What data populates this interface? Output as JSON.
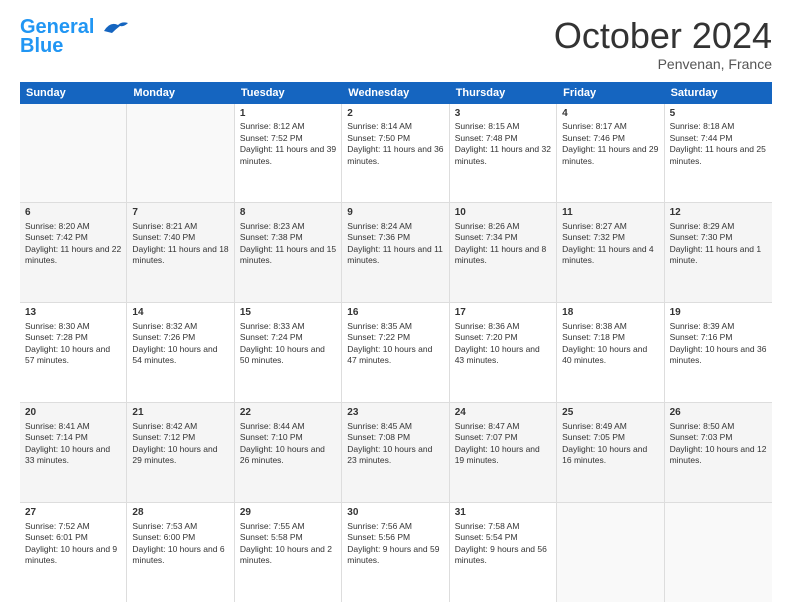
{
  "header": {
    "logo_line1": "General",
    "logo_line2": "Blue",
    "month": "October 2024",
    "location": "Penvenan, France"
  },
  "days_of_week": [
    "Sunday",
    "Monday",
    "Tuesday",
    "Wednesday",
    "Thursday",
    "Friday",
    "Saturday"
  ],
  "weeks": [
    [
      {
        "day": "",
        "empty": true
      },
      {
        "day": "",
        "empty": true
      },
      {
        "day": "1",
        "sunrise": "Sunrise: 8:12 AM",
        "sunset": "Sunset: 7:52 PM",
        "daylight": "Daylight: 11 hours and 39 minutes."
      },
      {
        "day": "2",
        "sunrise": "Sunrise: 8:14 AM",
        "sunset": "Sunset: 7:50 PM",
        "daylight": "Daylight: 11 hours and 36 minutes."
      },
      {
        "day": "3",
        "sunrise": "Sunrise: 8:15 AM",
        "sunset": "Sunset: 7:48 PM",
        "daylight": "Daylight: 11 hours and 32 minutes."
      },
      {
        "day": "4",
        "sunrise": "Sunrise: 8:17 AM",
        "sunset": "Sunset: 7:46 PM",
        "daylight": "Daylight: 11 hours and 29 minutes."
      },
      {
        "day": "5",
        "sunrise": "Sunrise: 8:18 AM",
        "sunset": "Sunset: 7:44 PM",
        "daylight": "Daylight: 11 hours and 25 minutes."
      }
    ],
    [
      {
        "day": "6",
        "sunrise": "Sunrise: 8:20 AM",
        "sunset": "Sunset: 7:42 PM",
        "daylight": "Daylight: 11 hours and 22 minutes."
      },
      {
        "day": "7",
        "sunrise": "Sunrise: 8:21 AM",
        "sunset": "Sunset: 7:40 PM",
        "daylight": "Daylight: 11 hours and 18 minutes."
      },
      {
        "day": "8",
        "sunrise": "Sunrise: 8:23 AM",
        "sunset": "Sunset: 7:38 PM",
        "daylight": "Daylight: 11 hours and 15 minutes."
      },
      {
        "day": "9",
        "sunrise": "Sunrise: 8:24 AM",
        "sunset": "Sunset: 7:36 PM",
        "daylight": "Daylight: 11 hours and 11 minutes."
      },
      {
        "day": "10",
        "sunrise": "Sunrise: 8:26 AM",
        "sunset": "Sunset: 7:34 PM",
        "daylight": "Daylight: 11 hours and 8 minutes."
      },
      {
        "day": "11",
        "sunrise": "Sunrise: 8:27 AM",
        "sunset": "Sunset: 7:32 PM",
        "daylight": "Daylight: 11 hours and 4 minutes."
      },
      {
        "day": "12",
        "sunrise": "Sunrise: 8:29 AM",
        "sunset": "Sunset: 7:30 PM",
        "daylight": "Daylight: 11 hours and 1 minute."
      }
    ],
    [
      {
        "day": "13",
        "sunrise": "Sunrise: 8:30 AM",
        "sunset": "Sunset: 7:28 PM",
        "daylight": "Daylight: 10 hours and 57 minutes."
      },
      {
        "day": "14",
        "sunrise": "Sunrise: 8:32 AM",
        "sunset": "Sunset: 7:26 PM",
        "daylight": "Daylight: 10 hours and 54 minutes."
      },
      {
        "day": "15",
        "sunrise": "Sunrise: 8:33 AM",
        "sunset": "Sunset: 7:24 PM",
        "daylight": "Daylight: 10 hours and 50 minutes."
      },
      {
        "day": "16",
        "sunrise": "Sunrise: 8:35 AM",
        "sunset": "Sunset: 7:22 PM",
        "daylight": "Daylight: 10 hours and 47 minutes."
      },
      {
        "day": "17",
        "sunrise": "Sunrise: 8:36 AM",
        "sunset": "Sunset: 7:20 PM",
        "daylight": "Daylight: 10 hours and 43 minutes."
      },
      {
        "day": "18",
        "sunrise": "Sunrise: 8:38 AM",
        "sunset": "Sunset: 7:18 PM",
        "daylight": "Daylight: 10 hours and 40 minutes."
      },
      {
        "day": "19",
        "sunrise": "Sunrise: 8:39 AM",
        "sunset": "Sunset: 7:16 PM",
        "daylight": "Daylight: 10 hours and 36 minutes."
      }
    ],
    [
      {
        "day": "20",
        "sunrise": "Sunrise: 8:41 AM",
        "sunset": "Sunset: 7:14 PM",
        "daylight": "Daylight: 10 hours and 33 minutes."
      },
      {
        "day": "21",
        "sunrise": "Sunrise: 8:42 AM",
        "sunset": "Sunset: 7:12 PM",
        "daylight": "Daylight: 10 hours and 29 minutes."
      },
      {
        "day": "22",
        "sunrise": "Sunrise: 8:44 AM",
        "sunset": "Sunset: 7:10 PM",
        "daylight": "Daylight: 10 hours and 26 minutes."
      },
      {
        "day": "23",
        "sunrise": "Sunrise: 8:45 AM",
        "sunset": "Sunset: 7:08 PM",
        "daylight": "Daylight: 10 hours and 23 minutes."
      },
      {
        "day": "24",
        "sunrise": "Sunrise: 8:47 AM",
        "sunset": "Sunset: 7:07 PM",
        "daylight": "Daylight: 10 hours and 19 minutes."
      },
      {
        "day": "25",
        "sunrise": "Sunrise: 8:49 AM",
        "sunset": "Sunset: 7:05 PM",
        "daylight": "Daylight: 10 hours and 16 minutes."
      },
      {
        "day": "26",
        "sunrise": "Sunrise: 8:50 AM",
        "sunset": "Sunset: 7:03 PM",
        "daylight": "Daylight: 10 hours and 12 minutes."
      }
    ],
    [
      {
        "day": "27",
        "sunrise": "Sunrise: 7:52 AM",
        "sunset": "Sunset: 6:01 PM",
        "daylight": "Daylight: 10 hours and 9 minutes."
      },
      {
        "day": "28",
        "sunrise": "Sunrise: 7:53 AM",
        "sunset": "Sunset: 6:00 PM",
        "daylight": "Daylight: 10 hours and 6 minutes."
      },
      {
        "day": "29",
        "sunrise": "Sunrise: 7:55 AM",
        "sunset": "Sunset: 5:58 PM",
        "daylight": "Daylight: 10 hours and 2 minutes."
      },
      {
        "day": "30",
        "sunrise": "Sunrise: 7:56 AM",
        "sunset": "Sunset: 5:56 PM",
        "daylight": "Daylight: 9 hours and 59 minutes."
      },
      {
        "day": "31",
        "sunrise": "Sunrise: 7:58 AM",
        "sunset": "Sunset: 5:54 PM",
        "daylight": "Daylight: 9 hours and 56 minutes."
      },
      {
        "day": "",
        "empty": true
      },
      {
        "day": "",
        "empty": true
      }
    ]
  ]
}
